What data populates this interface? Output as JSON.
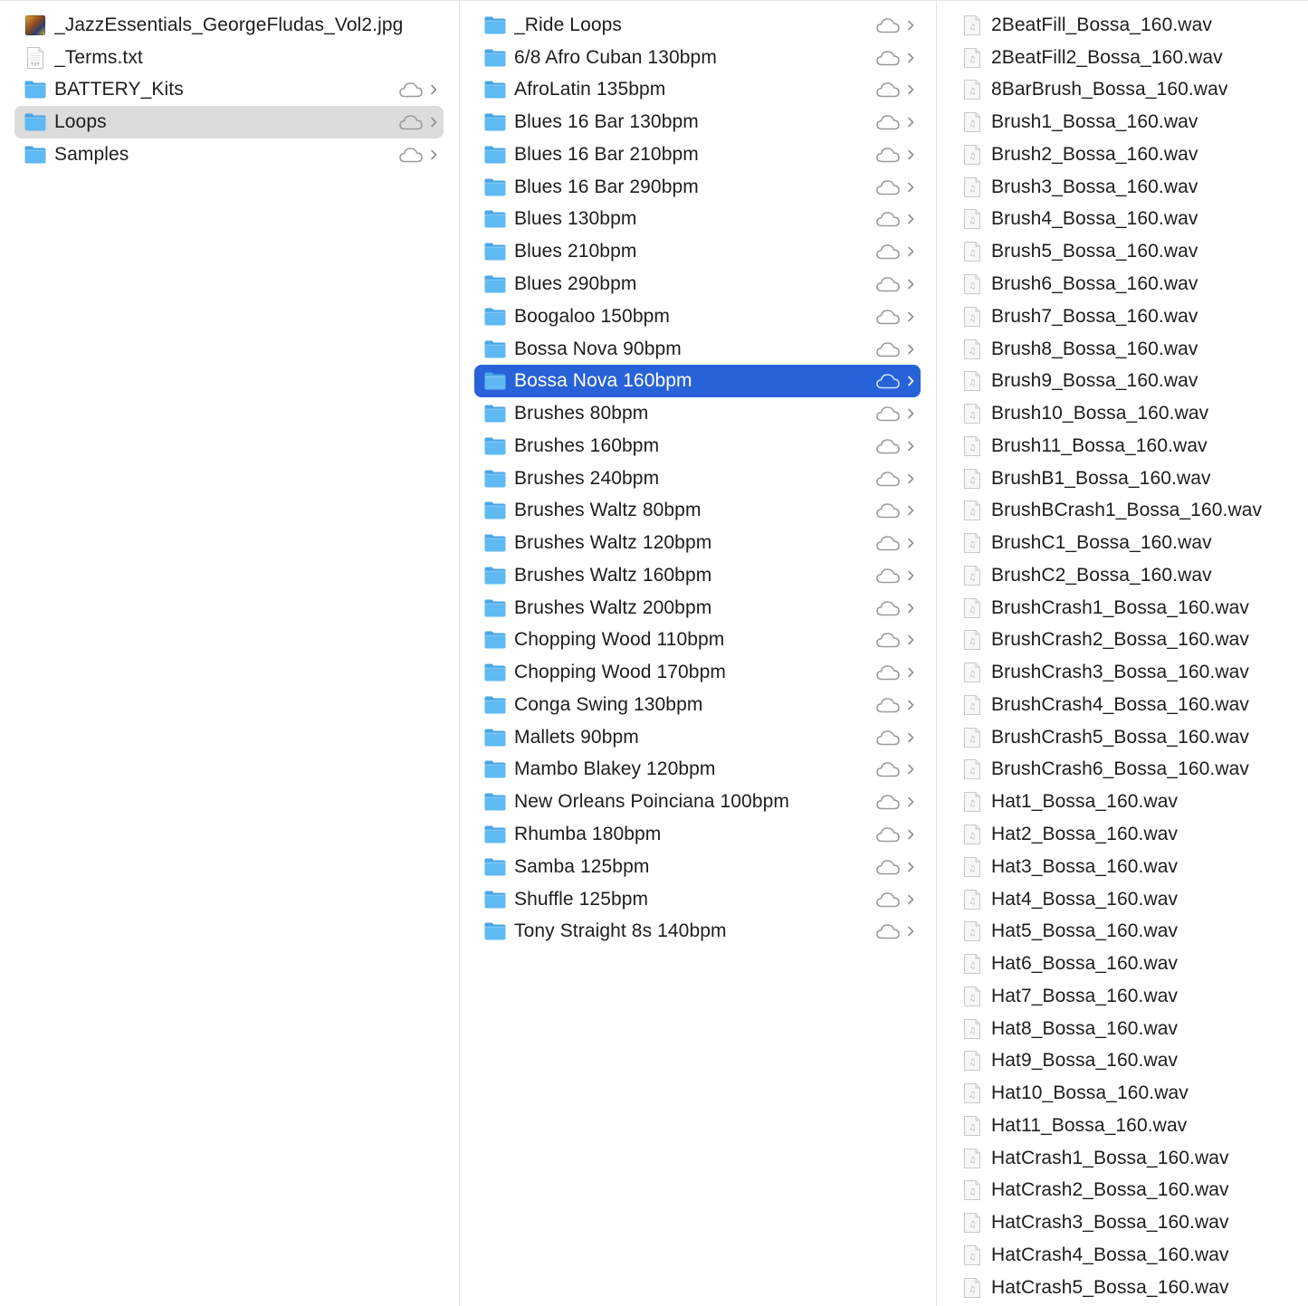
{
  "columns": [
    {
      "items": [
        {
          "label": "_JazzEssentials_GeorgeFludas_Vol2.jpg",
          "kind": "image",
          "icon": "image-thumbnail-icon",
          "cloud": false,
          "chevron": false,
          "state": "none"
        },
        {
          "label": "_Terms.txt",
          "kind": "text",
          "icon": "text-file-icon",
          "icon_text": "TXT",
          "cloud": false,
          "chevron": false,
          "state": "none"
        },
        {
          "label": "BATTERY_Kits",
          "kind": "folder",
          "icon": "folder-icon",
          "cloud": true,
          "chevron": true,
          "state": "none"
        },
        {
          "label": "Loops",
          "kind": "folder",
          "icon": "folder-icon",
          "cloud": true,
          "chevron": true,
          "state": "gray"
        },
        {
          "label": "Samples",
          "kind": "folder",
          "icon": "folder-icon",
          "cloud": true,
          "chevron": true,
          "state": "none"
        }
      ]
    },
    {
      "items": [
        {
          "label": "_Ride Loops",
          "kind": "folder",
          "icon": "folder-icon",
          "cloud": true,
          "chevron": true,
          "state": "none"
        },
        {
          "label": "6/8 Afro Cuban 130bpm",
          "kind": "folder",
          "icon": "folder-icon",
          "cloud": true,
          "chevron": true,
          "state": "none"
        },
        {
          "label": "AfroLatin 135bpm",
          "kind": "folder",
          "icon": "folder-icon",
          "cloud": true,
          "chevron": true,
          "state": "none"
        },
        {
          "label": "Blues 16 Bar 130bpm",
          "kind": "folder",
          "icon": "folder-icon",
          "cloud": true,
          "chevron": true,
          "state": "none"
        },
        {
          "label": "Blues 16 Bar 210bpm",
          "kind": "folder",
          "icon": "folder-icon",
          "cloud": true,
          "chevron": true,
          "state": "none"
        },
        {
          "label": "Blues 16 Bar 290bpm",
          "kind": "folder",
          "icon": "folder-icon",
          "cloud": true,
          "chevron": true,
          "state": "none"
        },
        {
          "label": "Blues 130bpm",
          "kind": "folder",
          "icon": "folder-icon",
          "cloud": true,
          "chevron": true,
          "state": "none"
        },
        {
          "label": "Blues 210bpm",
          "kind": "folder",
          "icon": "folder-icon",
          "cloud": true,
          "chevron": true,
          "state": "none"
        },
        {
          "label": "Blues 290bpm",
          "kind": "folder",
          "icon": "folder-icon",
          "cloud": true,
          "chevron": true,
          "state": "none"
        },
        {
          "label": "Boogaloo 150bpm",
          "kind": "folder",
          "icon": "folder-icon",
          "cloud": true,
          "chevron": true,
          "state": "none"
        },
        {
          "label": "Bossa Nova 90bpm",
          "kind": "folder",
          "icon": "folder-icon",
          "cloud": true,
          "chevron": true,
          "state": "none"
        },
        {
          "label": "Bossa Nova 160bpm",
          "kind": "folder",
          "icon": "folder-icon",
          "cloud": true,
          "chevron": true,
          "state": "blue"
        },
        {
          "label": "Brushes 80bpm",
          "kind": "folder",
          "icon": "folder-icon",
          "cloud": true,
          "chevron": true,
          "state": "none"
        },
        {
          "label": "Brushes 160bpm",
          "kind": "folder",
          "icon": "folder-icon",
          "cloud": true,
          "chevron": true,
          "state": "none"
        },
        {
          "label": "Brushes 240bpm",
          "kind": "folder",
          "icon": "folder-icon",
          "cloud": true,
          "chevron": true,
          "state": "none"
        },
        {
          "label": "Brushes Waltz 80bpm",
          "kind": "folder",
          "icon": "folder-icon",
          "cloud": true,
          "chevron": true,
          "state": "none"
        },
        {
          "label": "Brushes Waltz 120bpm",
          "kind": "folder",
          "icon": "folder-icon",
          "cloud": true,
          "chevron": true,
          "state": "none"
        },
        {
          "label": "Brushes Waltz 160bpm",
          "kind": "folder",
          "icon": "folder-icon",
          "cloud": true,
          "chevron": true,
          "state": "none"
        },
        {
          "label": "Brushes Waltz 200bpm",
          "kind": "folder",
          "icon": "folder-icon",
          "cloud": true,
          "chevron": true,
          "state": "none"
        },
        {
          "label": "Chopping Wood 110bpm",
          "kind": "folder",
          "icon": "folder-icon",
          "cloud": true,
          "chevron": true,
          "state": "none"
        },
        {
          "label": "Chopping Wood 170bpm",
          "kind": "folder",
          "icon": "folder-icon",
          "cloud": true,
          "chevron": true,
          "state": "none"
        },
        {
          "label": "Conga Swing 130bpm",
          "kind": "folder",
          "icon": "folder-icon",
          "cloud": true,
          "chevron": true,
          "state": "none"
        },
        {
          "label": "Mallets 90bpm",
          "kind": "folder",
          "icon": "folder-icon",
          "cloud": true,
          "chevron": true,
          "state": "none"
        },
        {
          "label": "Mambo Blakey 120bpm",
          "kind": "folder",
          "icon": "folder-icon",
          "cloud": true,
          "chevron": true,
          "state": "none"
        },
        {
          "label": "New Orleans Poinciana 100bpm",
          "kind": "folder",
          "icon": "folder-icon",
          "cloud": true,
          "chevron": true,
          "state": "none"
        },
        {
          "label": "Rhumba 180bpm",
          "kind": "folder",
          "icon": "folder-icon",
          "cloud": true,
          "chevron": true,
          "state": "none"
        },
        {
          "label": "Samba 125bpm",
          "kind": "folder",
          "icon": "folder-icon",
          "cloud": true,
          "chevron": true,
          "state": "none"
        },
        {
          "label": "Shuffle 125bpm",
          "kind": "folder",
          "icon": "folder-icon",
          "cloud": true,
          "chevron": true,
          "state": "none"
        },
        {
          "label": "Tony Straight 8s 140bpm",
          "kind": "folder",
          "icon": "folder-icon",
          "cloud": true,
          "chevron": true,
          "state": "none"
        }
      ]
    },
    {
      "items": [
        {
          "label": "2BeatFill_Bossa_160.wav",
          "kind": "audio",
          "icon": "audio-file-icon",
          "cloud": false,
          "chevron": false,
          "state": "none"
        },
        {
          "label": "2BeatFill2_Bossa_160.wav",
          "kind": "audio",
          "icon": "audio-file-icon",
          "cloud": false,
          "chevron": false,
          "state": "none"
        },
        {
          "label": "8BarBrush_Bossa_160.wav",
          "kind": "audio",
          "icon": "audio-file-icon",
          "cloud": false,
          "chevron": false,
          "state": "none"
        },
        {
          "label": "Brush1_Bossa_160.wav",
          "kind": "audio",
          "icon": "audio-file-icon",
          "cloud": false,
          "chevron": false,
          "state": "none"
        },
        {
          "label": "Brush2_Bossa_160.wav",
          "kind": "audio",
          "icon": "audio-file-icon",
          "cloud": false,
          "chevron": false,
          "state": "none"
        },
        {
          "label": "Brush3_Bossa_160.wav",
          "kind": "audio",
          "icon": "audio-file-icon",
          "cloud": false,
          "chevron": false,
          "state": "none"
        },
        {
          "label": "Brush4_Bossa_160.wav",
          "kind": "audio",
          "icon": "audio-file-icon",
          "cloud": false,
          "chevron": false,
          "state": "none"
        },
        {
          "label": "Brush5_Bossa_160.wav",
          "kind": "audio",
          "icon": "audio-file-icon",
          "cloud": false,
          "chevron": false,
          "state": "none"
        },
        {
          "label": "Brush6_Bossa_160.wav",
          "kind": "audio",
          "icon": "audio-file-icon",
          "cloud": false,
          "chevron": false,
          "state": "none"
        },
        {
          "label": "Brush7_Bossa_160.wav",
          "kind": "audio",
          "icon": "audio-file-icon",
          "cloud": false,
          "chevron": false,
          "state": "none"
        },
        {
          "label": "Brush8_Bossa_160.wav",
          "kind": "audio",
          "icon": "audio-file-icon",
          "cloud": false,
          "chevron": false,
          "state": "none"
        },
        {
          "label": "Brush9_Bossa_160.wav",
          "kind": "audio",
          "icon": "audio-file-icon",
          "cloud": false,
          "chevron": false,
          "state": "none"
        },
        {
          "label": "Brush10_Bossa_160.wav",
          "kind": "audio",
          "icon": "audio-file-icon",
          "cloud": false,
          "chevron": false,
          "state": "none"
        },
        {
          "label": "Brush11_Bossa_160.wav",
          "kind": "audio",
          "icon": "audio-file-icon",
          "cloud": false,
          "chevron": false,
          "state": "none"
        },
        {
          "label": "BrushB1_Bossa_160.wav",
          "kind": "audio",
          "icon": "audio-file-icon",
          "cloud": false,
          "chevron": false,
          "state": "none"
        },
        {
          "label": "BrushBCrash1_Bossa_160.wav",
          "kind": "audio",
          "icon": "audio-file-icon",
          "cloud": false,
          "chevron": false,
          "state": "none"
        },
        {
          "label": "BrushC1_Bossa_160.wav",
          "kind": "audio",
          "icon": "audio-file-icon",
          "cloud": false,
          "chevron": false,
          "state": "none"
        },
        {
          "label": "BrushC2_Bossa_160.wav",
          "kind": "audio",
          "icon": "audio-file-icon",
          "cloud": false,
          "chevron": false,
          "state": "none"
        },
        {
          "label": "BrushCrash1_Bossa_160.wav",
          "kind": "audio",
          "icon": "audio-file-icon",
          "cloud": false,
          "chevron": false,
          "state": "none"
        },
        {
          "label": "BrushCrash2_Bossa_160.wav",
          "kind": "audio",
          "icon": "audio-file-icon",
          "cloud": false,
          "chevron": false,
          "state": "none"
        },
        {
          "label": "BrushCrash3_Bossa_160.wav",
          "kind": "audio",
          "icon": "audio-file-icon",
          "cloud": false,
          "chevron": false,
          "state": "none"
        },
        {
          "label": "BrushCrash4_Bossa_160.wav",
          "kind": "audio",
          "icon": "audio-file-icon",
          "cloud": false,
          "chevron": false,
          "state": "none"
        },
        {
          "label": "BrushCrash5_Bossa_160.wav",
          "kind": "audio",
          "icon": "audio-file-icon",
          "cloud": false,
          "chevron": false,
          "state": "none"
        },
        {
          "label": "BrushCrash6_Bossa_160.wav",
          "kind": "audio",
          "icon": "audio-file-icon",
          "cloud": false,
          "chevron": false,
          "state": "none"
        },
        {
          "label": "Hat1_Bossa_160.wav",
          "kind": "audio",
          "icon": "audio-file-icon",
          "cloud": false,
          "chevron": false,
          "state": "none"
        },
        {
          "label": "Hat2_Bossa_160.wav",
          "kind": "audio",
          "icon": "audio-file-icon",
          "cloud": false,
          "chevron": false,
          "state": "none"
        },
        {
          "label": "Hat3_Bossa_160.wav",
          "kind": "audio",
          "icon": "audio-file-icon",
          "cloud": false,
          "chevron": false,
          "state": "none"
        },
        {
          "label": "Hat4_Bossa_160.wav",
          "kind": "audio",
          "icon": "audio-file-icon",
          "cloud": false,
          "chevron": false,
          "state": "none"
        },
        {
          "label": "Hat5_Bossa_160.wav",
          "kind": "audio",
          "icon": "audio-file-icon",
          "cloud": false,
          "chevron": false,
          "state": "none"
        },
        {
          "label": "Hat6_Bossa_160.wav",
          "kind": "audio",
          "icon": "audio-file-icon",
          "cloud": false,
          "chevron": false,
          "state": "none"
        },
        {
          "label": "Hat7_Bossa_160.wav",
          "kind": "audio",
          "icon": "audio-file-icon",
          "cloud": false,
          "chevron": false,
          "state": "none"
        },
        {
          "label": "Hat8_Bossa_160.wav",
          "kind": "audio",
          "icon": "audio-file-icon",
          "cloud": false,
          "chevron": false,
          "state": "none"
        },
        {
          "label": "Hat9_Bossa_160.wav",
          "kind": "audio",
          "icon": "audio-file-icon",
          "cloud": false,
          "chevron": false,
          "state": "none"
        },
        {
          "label": "Hat10_Bossa_160.wav",
          "kind": "audio",
          "icon": "audio-file-icon",
          "cloud": false,
          "chevron": false,
          "state": "none"
        },
        {
          "label": "Hat11_Bossa_160.wav",
          "kind": "audio",
          "icon": "audio-file-icon",
          "cloud": false,
          "chevron": false,
          "state": "none"
        },
        {
          "label": "HatCrash1_Bossa_160.wav",
          "kind": "audio",
          "icon": "audio-file-icon",
          "cloud": false,
          "chevron": false,
          "state": "none"
        },
        {
          "label": "HatCrash2_Bossa_160.wav",
          "kind": "audio",
          "icon": "audio-file-icon",
          "cloud": false,
          "chevron": false,
          "state": "none"
        },
        {
          "label": "HatCrash3_Bossa_160.wav",
          "kind": "audio",
          "icon": "audio-file-icon",
          "cloud": false,
          "chevron": false,
          "state": "none"
        },
        {
          "label": "HatCrash4_Bossa_160.wav",
          "kind": "audio",
          "icon": "audio-file-icon",
          "cloud": false,
          "chevron": false,
          "state": "none"
        },
        {
          "label": "HatCrash5_Bossa_160.wav",
          "kind": "audio",
          "icon": "audio-file-icon",
          "cloud": false,
          "chevron": false,
          "state": "none"
        }
      ]
    }
  ],
  "colors": {
    "folder_fill": "#5fb9f2",
    "folder_tab": "#4aa6e6",
    "selection_blue": "#2862d8",
    "selection_gray": "#dcdcdc",
    "accessory_gray": "#8e8e93"
  }
}
